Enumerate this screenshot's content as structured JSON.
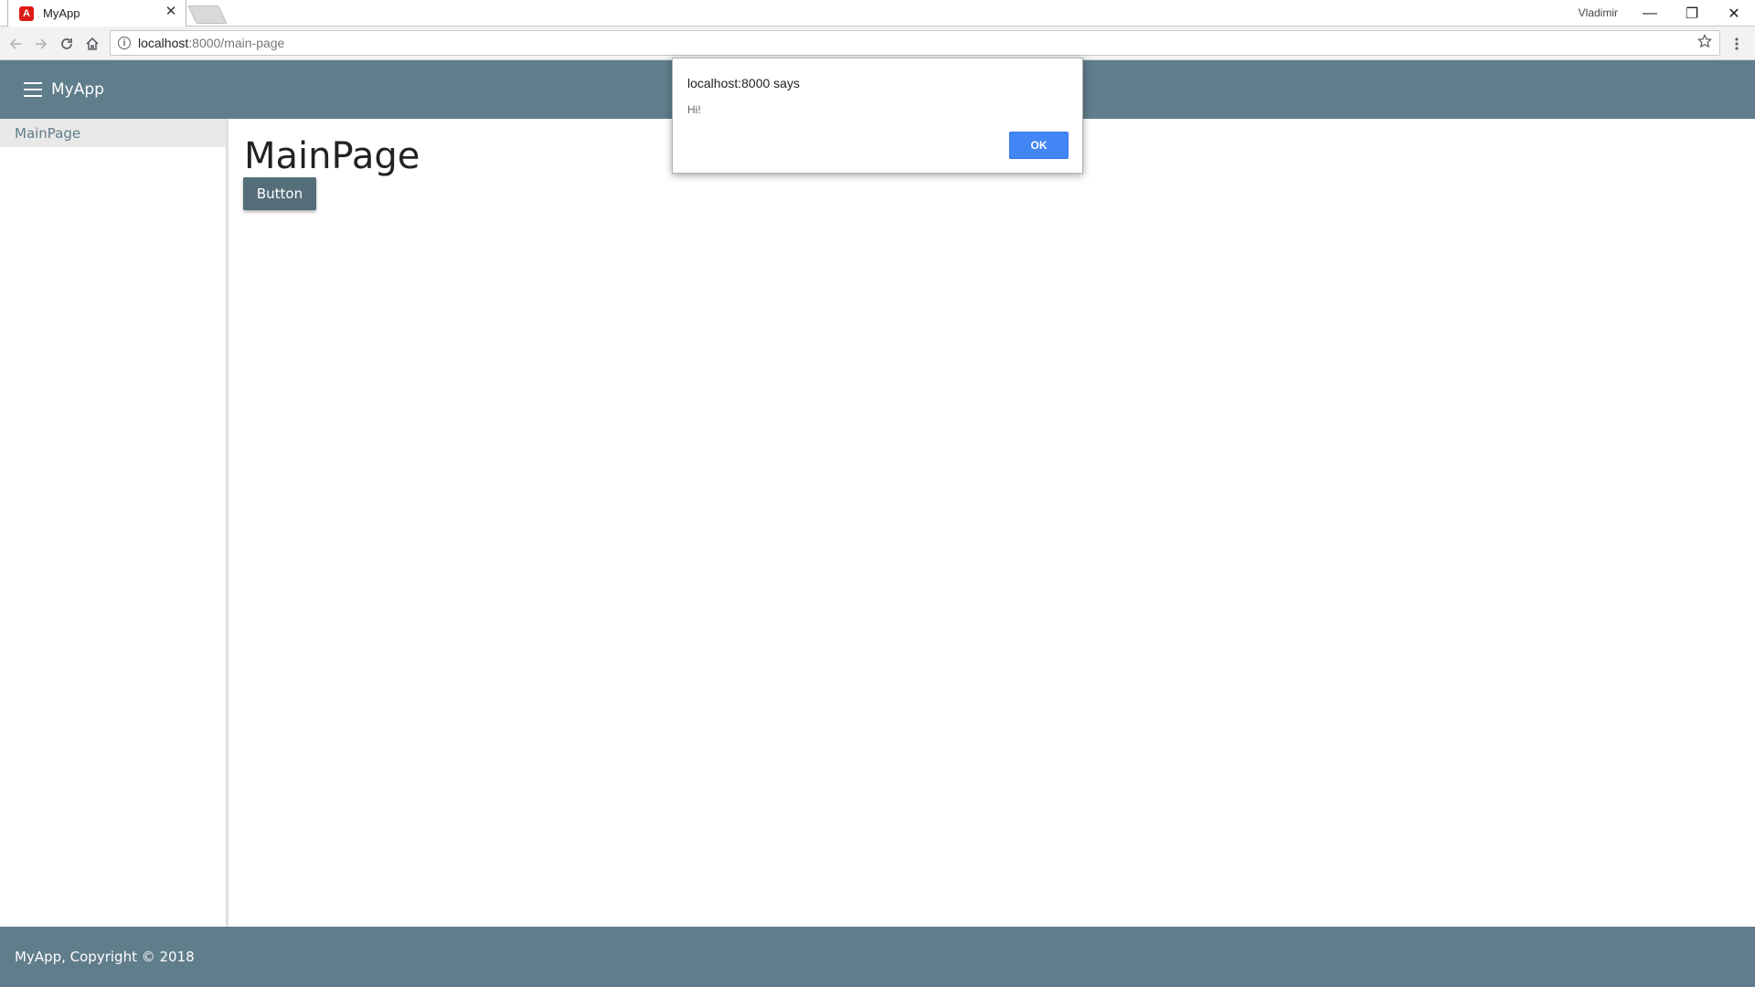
{
  "browser": {
    "tab_title": "MyApp",
    "tab_favicon_letter": "A",
    "close_glyph": "✕",
    "user_name": "Vladimir",
    "window_controls": {
      "minimize": "—",
      "restore": "❐",
      "close": "✕"
    },
    "url_host": "localhost",
    "url_rest": ":8000/main-page",
    "icons": {
      "back": "back-arrow-icon",
      "forward": "forward-arrow-icon",
      "reload": "reload-icon",
      "home": "home-icon",
      "info": "info-icon",
      "bookmark": "star-icon",
      "menu": "menu-dots-icon"
    }
  },
  "app": {
    "title": "MyApp",
    "header_color": "#607d8b",
    "sidebar": {
      "items": [
        {
          "label": "MainPage",
          "selected": true
        }
      ]
    },
    "main": {
      "page_title": "MainPage",
      "button_label": "Button"
    },
    "footer": {
      "text": "MyApp, Copyright © 2018"
    }
  },
  "alert": {
    "title": "localhost:8000 says",
    "message": "Hi!",
    "ok_label": "OK",
    "ok_color": "#4285f4"
  }
}
